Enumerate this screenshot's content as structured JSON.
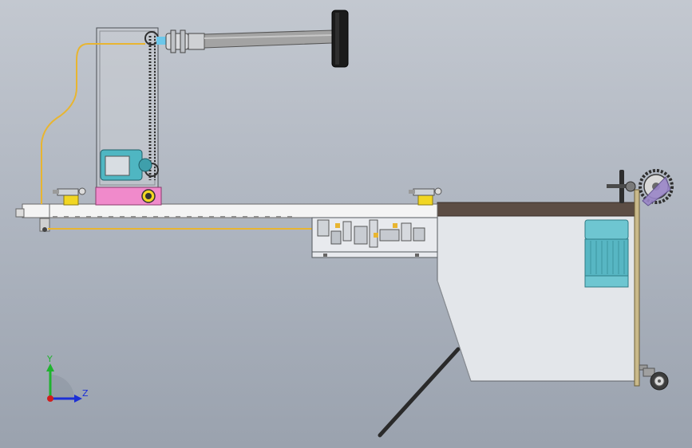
{
  "viewport": {
    "background_top": "#c3c8d0",
    "background_bottom": "#9aa2ae"
  },
  "triad": {
    "y_label": "Y",
    "z_label": "Z",
    "y_color": "#1fb32e",
    "z_color": "#1b2fd6",
    "x_color": "#d11d1d"
  },
  "colors": {
    "frame_white": "#f4f4f4",
    "frame_outline": "#6a6a6a",
    "top_plate": "#5c4d44",
    "cabinet": "#e3e6ea",
    "motor_teal": "#4fb6c2",
    "pink_base": "#f08acb",
    "sensor_yellow": "#f1d623",
    "cable_yellow": "#e8b531",
    "roller_gray": "#8f8f8f",
    "lavender": "#9a86c8"
  },
  "parts": [
    "left-enclosure",
    "drive-chain",
    "top-motor",
    "pink-base",
    "spindle-shaft",
    "end-disc",
    "sensor-left",
    "sensor-right",
    "guide-rail",
    "control-box",
    "cabinet-body",
    "right-motor",
    "handwheel",
    "sprocket-wheel",
    "support-leg",
    "caster-wheel",
    "diagonal-strut",
    "signal-cable"
  ]
}
